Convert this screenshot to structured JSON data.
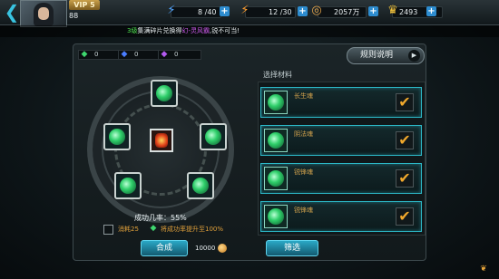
{
  "topbar": {
    "vip_label": "VIP 5",
    "player_level": "88",
    "stamina": "8 /40",
    "energy": "12 /30",
    "silver": "2057万",
    "gold": "2493"
  },
  "marquee": {
    "prefix": "3级",
    "text_before": "集满碎片兑换得",
    "highlight": "幻-灵风霸",
    "text_after": ",锐不可当!"
  },
  "currencies": [
    {
      "icon": "green-gem-icon",
      "value": "0",
      "color": "#3ed66e"
    },
    {
      "icon": "blue-gem-icon",
      "value": "0",
      "color": "#4a7dff"
    },
    {
      "icon": "purple-gem-icon",
      "value": "0",
      "color": "#b35af0"
    }
  ],
  "rules_button": "规则说明",
  "compose": {
    "success_rate": "成功几率：55%",
    "cost_label": "消耗25",
    "boost_label": "将成功率提升至100%",
    "compose_button": "合成",
    "coin_cost": "10000"
  },
  "materials": {
    "title": "选择材料",
    "items": [
      {
        "name": "长生魂",
        "checked": true
      },
      {
        "name": "阴法魂",
        "checked": true
      },
      {
        "name": "锐锋魂",
        "checked": true
      },
      {
        "name": "锐锋魂",
        "checked": true
      }
    ],
    "filter_button": "筛选"
  }
}
